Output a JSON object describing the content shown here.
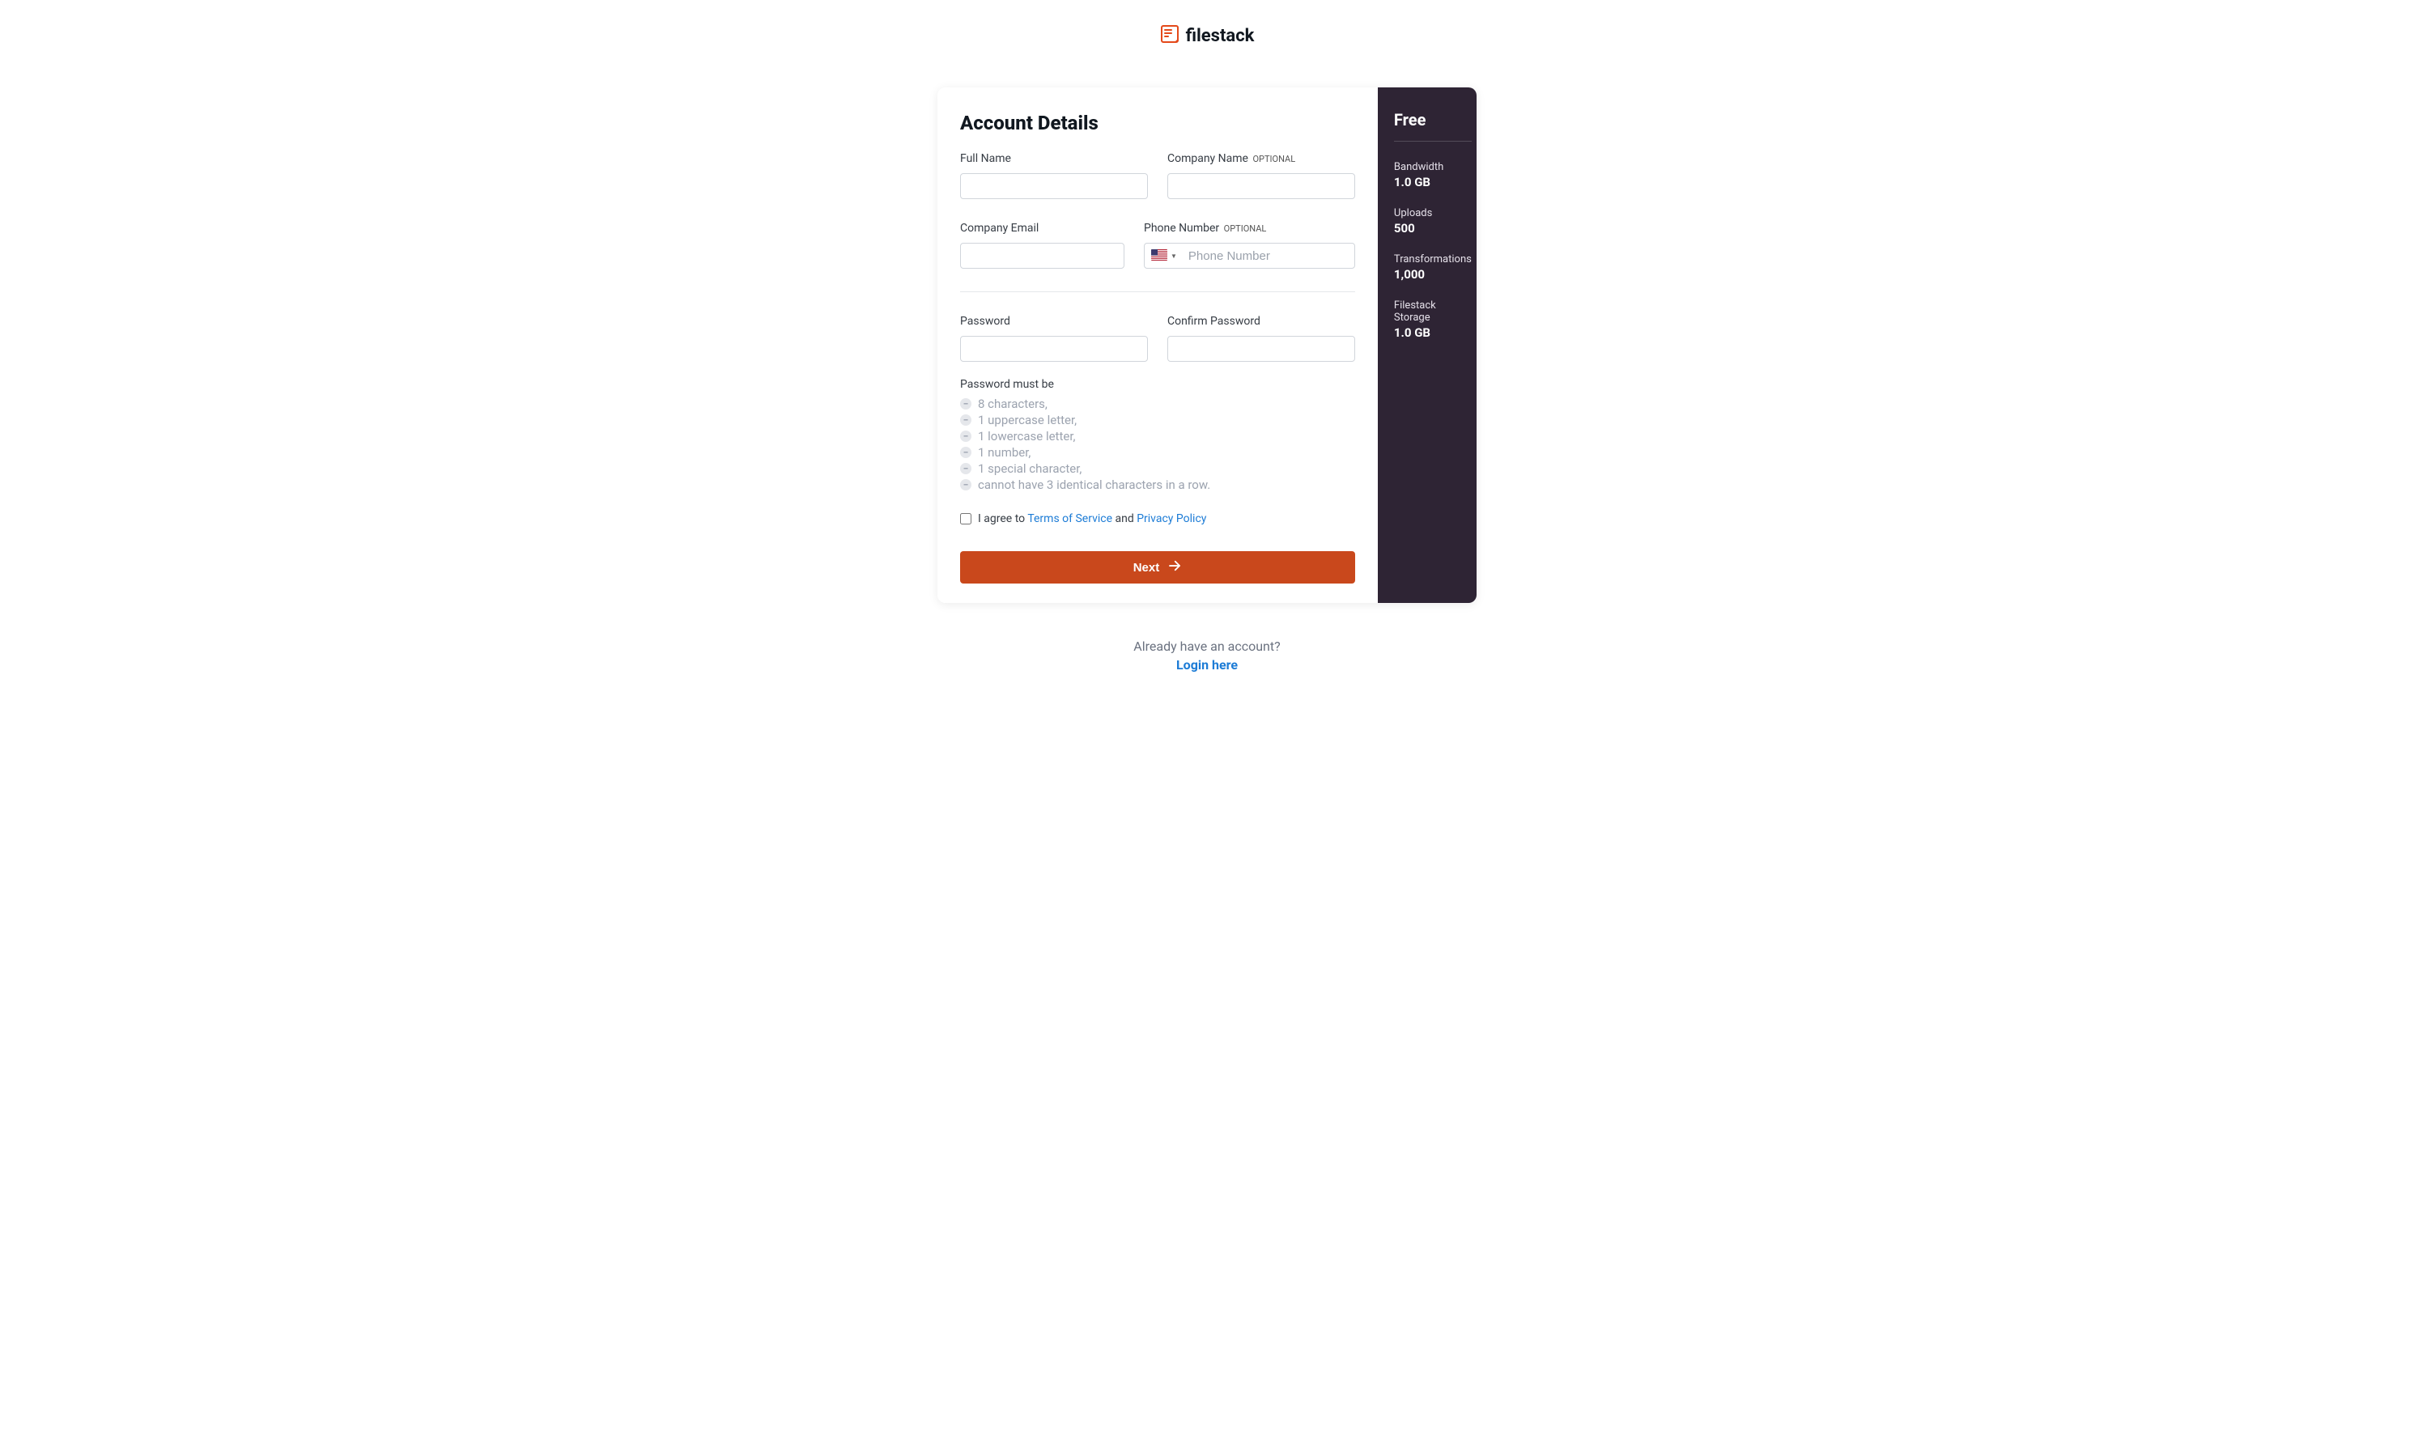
{
  "logo": {
    "text": "filestack"
  },
  "form": {
    "title": "Account Details",
    "fullName": {
      "label": "Full Name",
      "value": ""
    },
    "companyName": {
      "label": "Company Name",
      "optional": "OPTIONAL",
      "value": ""
    },
    "companyEmail": {
      "label": "Company Email",
      "value": ""
    },
    "phone": {
      "label": "Phone Number",
      "optional": "OPTIONAL",
      "placeholder": "Phone Number",
      "value": ""
    },
    "password": {
      "label": "Password",
      "value": ""
    },
    "confirmPassword": {
      "label": "Confirm Password",
      "value": ""
    },
    "passwordHintTitle": "Password must be",
    "passwordHints": [
      "8 characters,",
      "1 uppercase letter,",
      "1 lowercase letter,",
      "1 number,",
      "1 special character,",
      "cannot have 3 identical characters in a row."
    ],
    "agree": {
      "prefix": "I agree to ",
      "tos": "Terms of Service",
      "and": " and ",
      "privacy": "Privacy Policy"
    },
    "nextLabel": "Next"
  },
  "plan": {
    "name": "Free",
    "stats": [
      {
        "label": "Bandwidth",
        "value": "1.0 GB"
      },
      {
        "label": "Uploads",
        "value": "500"
      },
      {
        "label": "Transformations",
        "value": "1,000"
      },
      {
        "label": "Filestack Storage",
        "value": "1.0 GB"
      }
    ]
  },
  "footer": {
    "text": "Already have an account?",
    "link": "Login here"
  }
}
